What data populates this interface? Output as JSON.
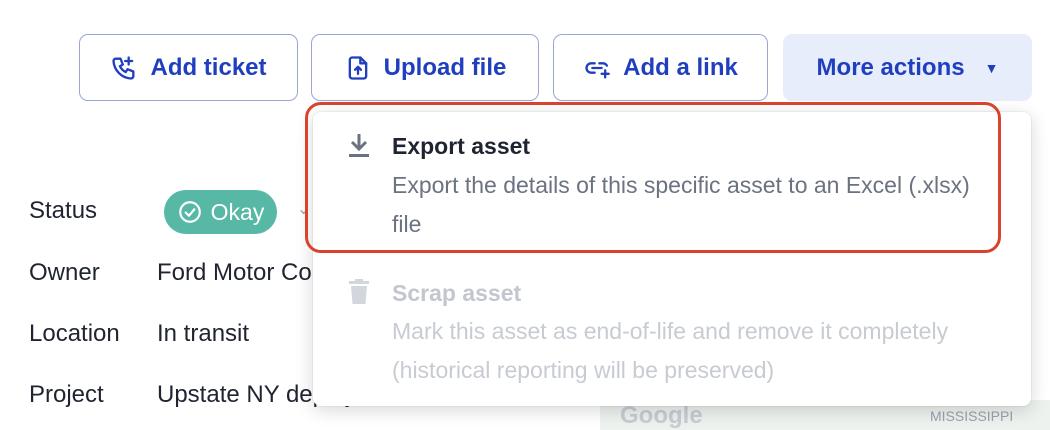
{
  "toolbar": {
    "add_ticket": "Add ticket",
    "upload_file": "Upload file",
    "add_link": "Add a link",
    "more_actions": "More actions"
  },
  "details": {
    "status_label": "Status",
    "status_value": "Okay",
    "owner_label": "Owner",
    "owner_value": "Ford Motor Co",
    "location_label": "Location",
    "location_value": "In transit",
    "project_label": "Project",
    "project_value": "Upstate NY deploy"
  },
  "map": {
    "logo_text": "Google",
    "region_text": "MISSISSIPPI"
  },
  "menu": {
    "items": [
      {
        "title": "Export asset",
        "description": "Export the details of this specific asset to an Excel (.xlsx) file",
        "icon": "download-icon",
        "enabled": true,
        "highlighted": true
      },
      {
        "title": "Scrap asset",
        "description": "Mark this asset as end-of-life and remove it completely (historical reporting will be preserved)",
        "icon": "trash-icon",
        "enabled": false
      }
    ]
  },
  "colors": {
    "primary": "#1f3fbf",
    "status_ok": "#56b8a5",
    "highlight_border": "#d9432c",
    "more_actions_bg": "#e8edfb"
  }
}
